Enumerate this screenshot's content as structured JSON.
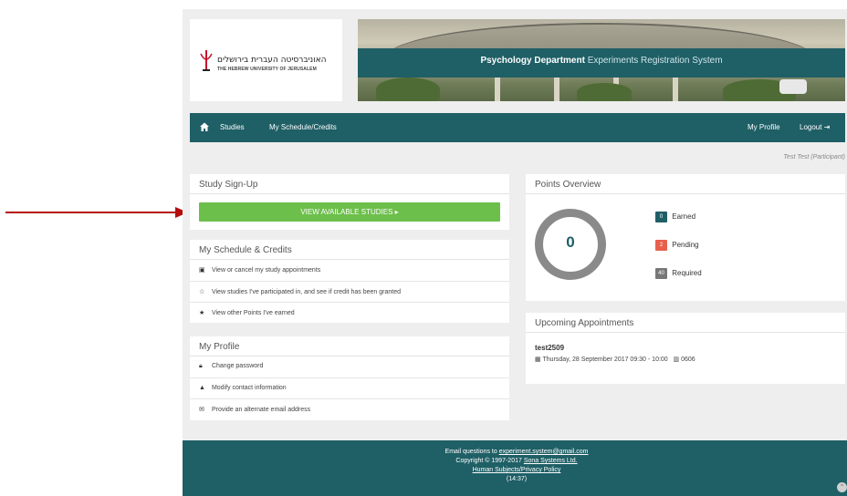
{
  "header": {
    "logo_hebrew": "האוניברסיטה העברית בירושלים",
    "logo_english": "THE HEBREW UNIVERSITY OF JERUSALEM",
    "banner_title_bold": "Psychology Department",
    "banner_title_rest": "Experiments Registration System"
  },
  "nav": {
    "studies": "Studies",
    "schedule": "My Schedule/Credits",
    "profile": "My Profile",
    "logout": "Logout"
  },
  "user_line": "Test Test (Participant)",
  "signup": {
    "title": "Study Sign-Up",
    "button": "VIEW AVAILABLE STUDIES"
  },
  "schedule_panel": {
    "title": "My Schedule & Credits",
    "items": [
      "View or cancel my study appointments",
      "View studies I've participated in, and see if credit has been granted",
      "View other Points I've earned"
    ]
  },
  "profile_panel": {
    "title": "My Profile",
    "items": [
      "Change password",
      "Modify contact information",
      "Provide an alternate email address"
    ]
  },
  "points": {
    "title": "Points Overview",
    "total": "0",
    "earned_value": "0",
    "earned_label": "Earned",
    "pending_value": "2",
    "pending_label": "Pending",
    "required_value": "40",
    "required_label": "Required"
  },
  "appointments": {
    "title": "Upcoming Appointments",
    "name": "test2509",
    "datetime": "Thursday, 28 September 2017 09:30 - 10:00",
    "room": "0606"
  },
  "footer": {
    "email_prefix": "Email questions to",
    "email": "experiment.system@gmail.com",
    "copyright": "Copyright © 1997-2017",
    "company": "Sona Systems Ltd.",
    "privacy": "Human Subjects/Privacy Policy",
    "time": "(14:37)"
  },
  "colors": {
    "teal": "#1f5f66",
    "green": "#6dbf4b",
    "earned_badge": "#1f5f66",
    "pending_badge": "#e8604c",
    "required_badge": "#777777",
    "arrow": "#b50d0d"
  },
  "icons": {
    "nav_home": "home-icon",
    "button_arrow": "circle-arrow-right-icon",
    "schedule_items": [
      "edit-square-icon",
      "star-half-icon",
      "star-icon"
    ],
    "profile_items": [
      "lock-icon",
      "user-icon",
      "envelope-icon"
    ],
    "appointment_date": "calendar-icon",
    "appointment_room": "building-icon"
  }
}
